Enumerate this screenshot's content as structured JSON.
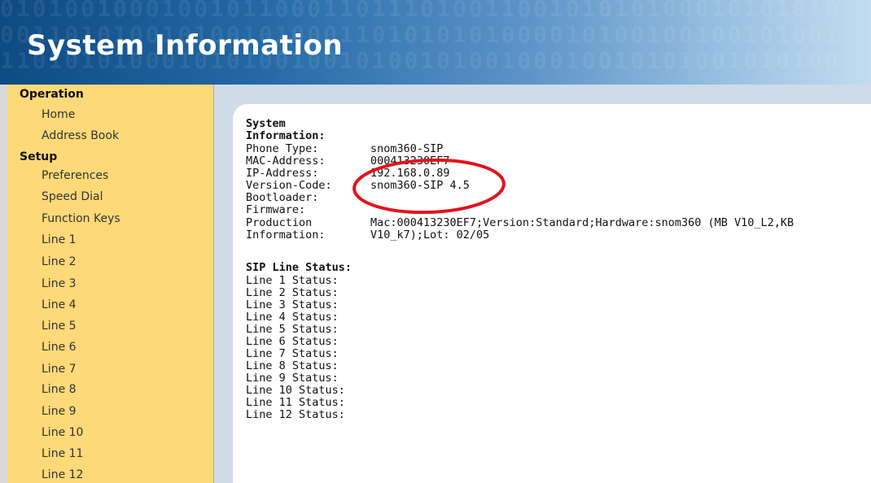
{
  "header": {
    "title": "System Information",
    "binary_rows": [
      "0101001000100101100011011101001100101010100010101010",
      "0011010100101001010001101010101000010100100100101001",
      "1101010100010101001001010010100100010010101001010100"
    ]
  },
  "sidebar": {
    "sections": [
      {
        "label": "Operation",
        "items": [
          "Home",
          "Address Book"
        ]
      },
      {
        "label": "Setup",
        "items": [
          "Preferences",
          "Speed Dial",
          "Function Keys",
          "Line 1",
          "Line 2",
          "Line 3",
          "Line 4",
          "Line 5",
          "Line 6",
          "Line 7",
          "Line 8",
          "Line 9",
          "Line 10",
          "Line 11",
          "Line 12"
        ]
      }
    ]
  },
  "system_info": {
    "heading_line1": "System",
    "heading_line2": "Information:",
    "rows": [
      {
        "label": "Phone Type:",
        "value": "snom360-SIP"
      },
      {
        "label": "MAC-Address:",
        "value": "000413230EF7"
      },
      {
        "label": "IP-Address:",
        "value": "192.168.0.89"
      },
      {
        "label": "Version-Code:",
        "value": "snom360-SIP 4.5"
      },
      {
        "label": "Bootloader:",
        "value": ""
      },
      {
        "label": "Firmware:",
        "value": ""
      }
    ],
    "production_label_1": "Production",
    "production_label_2": "Information:",
    "production_value_1": "Mac:000413230EF7;Version:Standard;Hardware:snom360 (MB V10_L2,KB",
    "production_value_2": "V10_k7);Lot: 02/05"
  },
  "sip_status": {
    "heading": "SIP Line Status:",
    "lines": [
      "Line 1 Status:",
      "Line 2 Status:",
      "Line 3 Status:",
      "Line 4 Status:",
      "Line 5 Status:",
      "Line 6 Status:",
      "Line 7 Status:",
      "Line 8 Status:",
      "Line 9 Status:",
      "Line 10 Status:",
      "Line 11 Status:",
      "Line 12 Status:"
    ]
  },
  "annotation": {
    "color": "#e0141e"
  }
}
